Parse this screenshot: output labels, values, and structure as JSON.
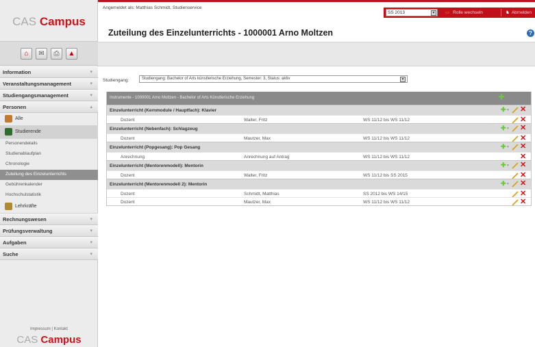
{
  "app": {
    "logo_cas": "CAS",
    "logo_campus": "Campus"
  },
  "header": {
    "logged_in": "Angemeldet als: Matthias Schmidt, Studienservice",
    "semester": "SS 2013",
    "role_switch": "Rolle wechseln",
    "logout": "Abmelden",
    "page_title": "Zuteilung des Einzelunterrichts - 1000001 Arno Moltzen"
  },
  "sidebar": {
    "sections": [
      {
        "label": "Information"
      },
      {
        "label": "Veranstaltungsmanagement"
      },
      {
        "label": "Studiengangsmanagement"
      },
      {
        "label": "Personen"
      }
    ],
    "persons": {
      "alle": "Alle",
      "studierende": "Studierende",
      "leaves": [
        "Personendetails",
        "Studienablaufplan",
        "Chronologie",
        "Zuteilung des Einzelunterrichts",
        "Gebührenkalender",
        "Hochschulstatistik"
      ],
      "lehrkraefte": "Lehrkräfte"
    },
    "lower_sections": [
      {
        "label": "Rechnungswesen"
      },
      {
        "label": "Prüfungsverwaltung"
      },
      {
        "label": "Aufgaben"
      },
      {
        "label": "Suche"
      }
    ],
    "imprint": "Impressum | Kontakt"
  },
  "filter": {
    "label": "Studiengang:",
    "value": "Studiengang: Bachelor of Arts künstlerische Erziehung, Semester: 3, Status: aktiv"
  },
  "table": {
    "header": "Instrumente - 1000001 Arno Moltzen - Bachelor of Arts Künstlerische Erziehung",
    "groups": [
      {
        "title": "Einzelunterricht (Kernmodule / Hauptfach): Klavier",
        "rows": [
          {
            "role": "Dozent",
            "person": "Walter, Fritz",
            "period": "WS 11/12 bis WS 11/12"
          }
        ]
      },
      {
        "title": "Einzelunterricht (Nebenfach): Schlagzeug",
        "rows": [
          {
            "role": "Dozent",
            "person": "Mautzer, Max",
            "period": "WS 11/12 bis WS 11/12"
          }
        ]
      },
      {
        "title": "Einzelunterricht (Popgesang): Pop Gesang",
        "rows": [
          {
            "role": "Anrechnung",
            "person": "Anrechnung auf Antrag",
            "period": "WS 11/12 bis WS 11/12"
          }
        ]
      },
      {
        "title": "Einzelunterricht (Mentorenmodell): Mentorin",
        "rows": [
          {
            "role": "Dozent",
            "person": "Walter, Fritz",
            "period": "WS 11/12 bis SS 2015"
          }
        ]
      },
      {
        "title": "Einzelunterricht (Mentorenmodell 2): Mentorin",
        "rows": [
          {
            "role": "Dozent",
            "person": "Schmidt, Matthias",
            "period": "SS 2012 bis WS 14/15"
          },
          {
            "role": "Dozent",
            "person": "Mautzer, Max",
            "period": "WS 11/12 bis WS 11/12"
          }
        ]
      }
    ]
  },
  "colors": {
    "brand_red": "#c0101a",
    "add_green": "#66cc33",
    "delete_red": "#d0121b",
    "edit_gold": "#d9a21b"
  }
}
